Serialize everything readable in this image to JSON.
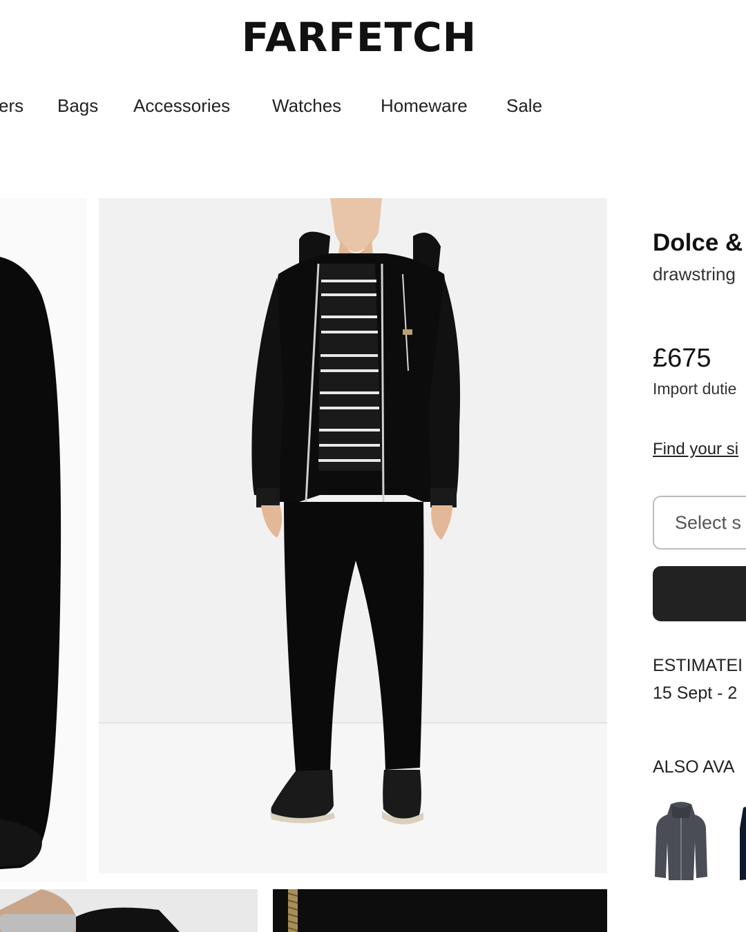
{
  "brand_logo": "FARFETCH",
  "nav": {
    "items": [
      "ers",
      "Bags",
      "Accessories",
      "Watches",
      "Homeware",
      "Sale"
    ]
  },
  "product": {
    "brand": "Dolce &",
    "description": "drawstring",
    "price": "£675",
    "duties_note": "Import dutie",
    "size_guide_link": "Find your si",
    "size_select_placeholder": "Select s",
    "delivery_label": "ESTIMATEI",
    "delivery_dates": "15 Sept - 2",
    "also_available_label": "ALSO AVA"
  },
  "colors": {
    "text": "#222222",
    "button": "#222222",
    "swatch_grey": "#4a4d55"
  }
}
